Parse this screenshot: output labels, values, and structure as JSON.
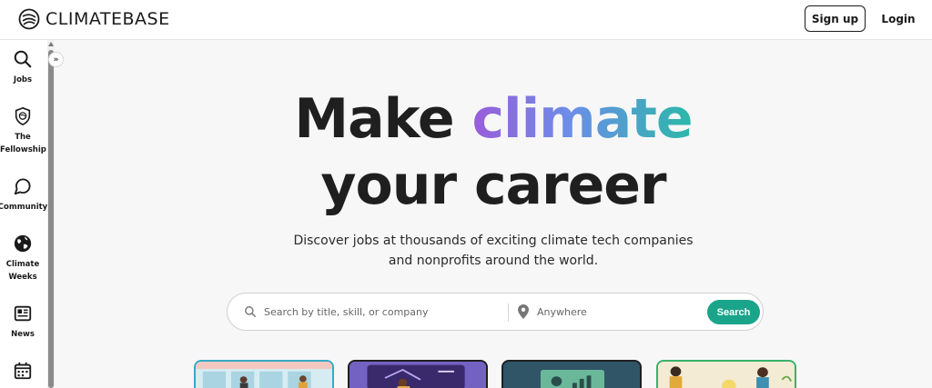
{
  "header": {
    "brand": "CLIMATEBASE",
    "signup_label": "Sign up",
    "login_label": "Login"
  },
  "sidebar": {
    "collapse_icon": "»",
    "items": [
      {
        "label": "Jobs",
        "icon": "search-icon"
      },
      {
        "label": "The Fellowship",
        "icon": "shield-icon"
      },
      {
        "label": "Community",
        "icon": "chat-bubble-icon"
      },
      {
        "label": "Climate Weeks",
        "icon": "globe-icon"
      },
      {
        "label": "News",
        "icon": "newspaper-icon"
      },
      {
        "label": "",
        "icon": "calendar-icon"
      }
    ]
  },
  "hero": {
    "line1_prefix": "Make ",
    "line1_highlight": "climate",
    "line2": "your career",
    "subtitle_line1": "Discover jobs at thousands of exciting climate tech companies",
    "subtitle_line2": "and nonprofits around the world.",
    "gradient": [
      "#9a5cd9",
      "#6b8ee8",
      "#2bb8a8"
    ]
  },
  "search": {
    "query_placeholder": "Search by title, skill, or company",
    "location_placeholder": "Anywhere",
    "button_label": "Search",
    "button_color": "#1aa58a"
  },
  "cards": [
    {
      "name": "office-illustration",
      "border": "#36a9c4"
    },
    {
      "name": "presenter-illustration",
      "border": "#1f1f1f"
    },
    {
      "name": "dashboard-illustration",
      "border": "#1f1f1f"
    },
    {
      "name": "team-illustration",
      "border": "#39b26b"
    }
  ]
}
